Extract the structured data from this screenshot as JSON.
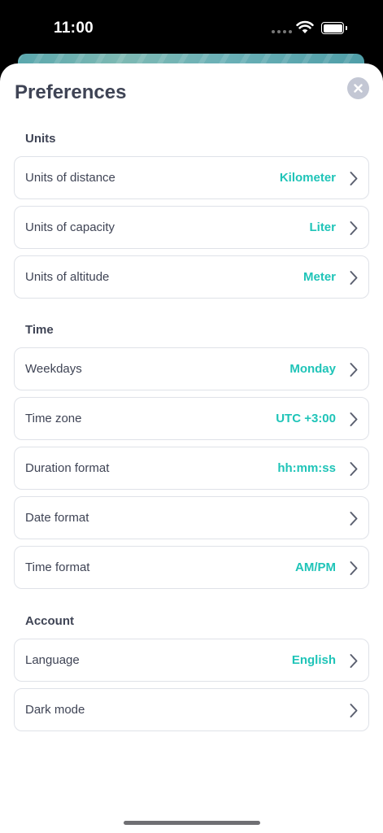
{
  "status": {
    "time": "11:00"
  },
  "sheet": {
    "title": "Preferences",
    "sections": [
      {
        "title": "Units",
        "rows": [
          {
            "label": "Units of distance",
            "value": "Kilometer"
          },
          {
            "label": "Units of capacity",
            "value": "Liter"
          },
          {
            "label": "Units of altitude",
            "value": "Meter"
          }
        ]
      },
      {
        "title": "Time",
        "rows": [
          {
            "label": "Weekdays",
            "value": "Monday"
          },
          {
            "label": "Time zone",
            "value": "UTC +3:00"
          },
          {
            "label": "Duration format",
            "value": "hh:mm:ss"
          },
          {
            "label": "Date format",
            "value": ""
          },
          {
            "label": "Time format",
            "value": "AM/PM"
          }
        ]
      },
      {
        "title": "Account",
        "rows": [
          {
            "label": "Language",
            "value": "English"
          },
          {
            "label": "Dark mode",
            "value": ""
          }
        ]
      }
    ]
  },
  "colors": {
    "accent": "#1fc4b8",
    "text": "#3f4455",
    "border": "#dfe2e8"
  }
}
